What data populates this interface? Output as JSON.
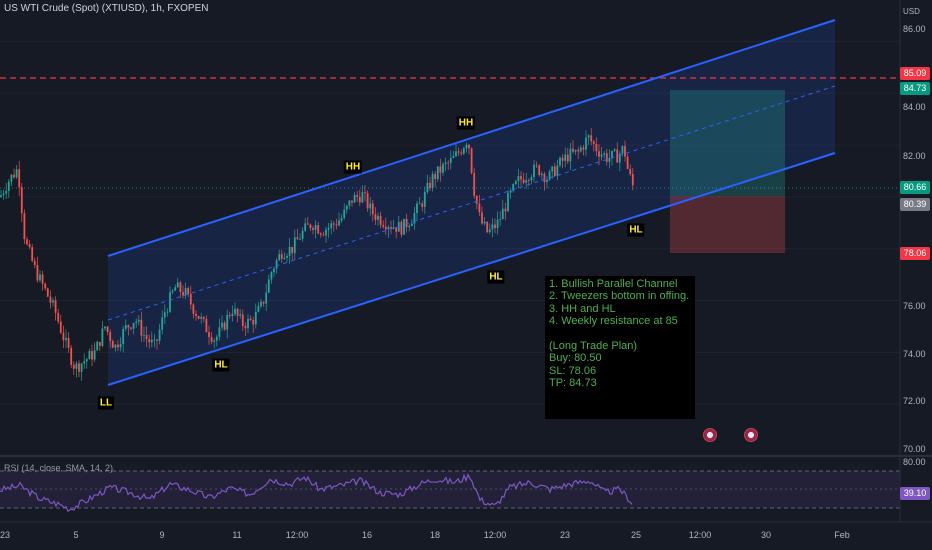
{
  "header": {
    "symbol_title": "US WTI Crude (Spot) (XTIUSD), 1h, FXOPEN",
    "currency": "USD"
  },
  "rsi_panel": {
    "title": "RSI (14, close, SMA, 14, 2)",
    "upper_label": "80.00",
    "value_label": "39.10"
  },
  "price_axis": {
    "ticks": [
      "86.00",
      "84.00",
      "82.00",
      "76.00",
      "74.00",
      "72.00",
      "70.00"
    ]
  },
  "price_tags": {
    "resistance": "85.09",
    "take_profit": "84.73",
    "current": "80.66",
    "entry": "80.39",
    "stop_loss": "78.06"
  },
  "date_axis": {
    "ticks": [
      "23",
      "5",
      "9",
      "11",
      "12:00",
      "16",
      "18",
      "12:00",
      "23",
      "25",
      "12:00",
      "30",
      "Feb"
    ]
  },
  "pattern_labels": {
    "ll": "LL",
    "hl_1": "HL",
    "hh_1": "HH",
    "hh_2": "HH",
    "hl_2": "HL",
    "hl_3": "HL"
  },
  "notes": {
    "lines": [
      "1. Bullish Parallel Channel",
      "2. Tweezers bottom in offing.",
      "3. HH and HL",
      "4. Weekly resistance at 85",
      "",
      "(Long Trade Plan)",
      "Buy: 80.50",
      "SL: 78.06",
      "TP: 84.73"
    ]
  },
  "colors": {
    "background": "#161a25",
    "bull_candle": "#26a69a",
    "bear_candle": "#ef5350",
    "channel_line": "#2962ff",
    "resistance_line": "#f23645",
    "rsi_line": "#7e57c2",
    "note_text": "#4caf50",
    "label_text": "#ffeb3b"
  },
  "chart_data": {
    "type": "candlestick",
    "y_range": [
      70,
      87.6
    ],
    "x_range_labels": [
      "23",
      "Feb"
    ],
    "resistance_level": 85.09,
    "trade": {
      "entry": 80.39,
      "stop_loss": 78.06,
      "take_profit": 84.73
    },
    "close_path": [
      {
        "x": 0,
        "y": 80.0
      },
      {
        "x": 8,
        "y": 80.6
      },
      {
        "x": 18,
        "y": 81.1
      },
      {
        "x": 25,
        "y": 78.3
      },
      {
        "x": 35,
        "y": 77.2
      },
      {
        "x": 45,
        "y": 76.4
      },
      {
        "x": 55,
        "y": 75.6
      },
      {
        "x": 65,
        "y": 74.4
      },
      {
        "x": 75,
        "y": 73.4
      },
      {
        "x": 85,
        "y": 73.7
      },
      {
        "x": 95,
        "y": 74.0
      },
      {
        "x": 105,
        "y": 75.0
      },
      {
        "x": 115,
        "y": 74.2
      },
      {
        "x": 125,
        "y": 74.9
      },
      {
        "x": 135,
        "y": 75.3
      },
      {
        "x": 145,
        "y": 74.6
      },
      {
        "x": 155,
        "y": 74.2
      },
      {
        "x": 165,
        "y": 75.6
      },
      {
        "x": 175,
        "y": 76.5
      },
      {
        "x": 185,
        "y": 76.3
      },
      {
        "x": 195,
        "y": 75.6
      },
      {
        "x": 205,
        "y": 75.0
      },
      {
        "x": 215,
        "y": 74.5
      },
      {
        "x": 222,
        "y": 74.9
      },
      {
        "x": 232,
        "y": 75.7
      },
      {
        "x": 242,
        "y": 75.1
      },
      {
        "x": 252,
        "y": 75.2
      },
      {
        "x": 262,
        "y": 75.8
      },
      {
        "x": 272,
        "y": 77.2
      },
      {
        "x": 282,
        "y": 77.9
      },
      {
        "x": 292,
        "y": 78.0
      },
      {
        "x": 302,
        "y": 78.6
      },
      {
        "x": 312,
        "y": 79.0
      },
      {
        "x": 322,
        "y": 78.7
      },
      {
        "x": 332,
        "y": 78.9
      },
      {
        "x": 342,
        "y": 79.2
      },
      {
        "x": 352,
        "y": 79.9
      },
      {
        "x": 362,
        "y": 80.1
      },
      {
        "x": 372,
        "y": 79.4
      },
      {
        "x": 382,
        "y": 79.1
      },
      {
        "x": 392,
        "y": 78.9
      },
      {
        "x": 402,
        "y": 78.8
      },
      {
        "x": 412,
        "y": 79.2
      },
      {
        "x": 422,
        "y": 79.8
      },
      {
        "x": 432,
        "y": 80.7
      },
      {
        "x": 442,
        "y": 81.1
      },
      {
        "x": 452,
        "y": 81.4
      },
      {
        "x": 462,
        "y": 81.9
      },
      {
        "x": 468,
        "y": 82.3
      },
      {
        "x": 474,
        "y": 80.3
      },
      {
        "x": 480,
        "y": 79.1
      },
      {
        "x": 488,
        "y": 78.6
      },
      {
        "x": 498,
        "y": 79.0
      },
      {
        "x": 508,
        "y": 79.9
      },
      {
        "x": 518,
        "y": 80.6
      },
      {
        "x": 528,
        "y": 80.9
      },
      {
        "x": 538,
        "y": 81.1
      },
      {
        "x": 548,
        "y": 80.7
      },
      {
        "x": 558,
        "y": 81.2
      },
      {
        "x": 568,
        "y": 81.6
      },
      {
        "x": 578,
        "y": 81.7
      },
      {
        "x": 588,
        "y": 82.3
      },
      {
        "x": 598,
        "y": 81.8
      },
      {
        "x": 608,
        "y": 81.5
      },
      {
        "x": 618,
        "y": 81.6
      },
      {
        "x": 624,
        "y": 81.9
      },
      {
        "x": 628,
        "y": 81.0
      },
      {
        "x": 633,
        "y": 80.4
      }
    ],
    "rsi_path": [
      {
        "x": 0,
        "y": 55
      },
      {
        "x": 20,
        "y": 60
      },
      {
        "x": 40,
        "y": 45
      },
      {
        "x": 60,
        "y": 38
      },
      {
        "x": 70,
        "y": 33
      },
      {
        "x": 90,
        "y": 45
      },
      {
        "x": 110,
        "y": 58
      },
      {
        "x": 130,
        "y": 52
      },
      {
        "x": 150,
        "y": 44
      },
      {
        "x": 170,
        "y": 62
      },
      {
        "x": 190,
        "y": 55
      },
      {
        "x": 210,
        "y": 46
      },
      {
        "x": 230,
        "y": 57
      },
      {
        "x": 250,
        "y": 50
      },
      {
        "x": 270,
        "y": 68
      },
      {
        "x": 290,
        "y": 62
      },
      {
        "x": 305,
        "y": 70
      },
      {
        "x": 320,
        "y": 56
      },
      {
        "x": 340,
        "y": 60
      },
      {
        "x": 360,
        "y": 66
      },
      {
        "x": 380,
        "y": 52
      },
      {
        "x": 400,
        "y": 50
      },
      {
        "x": 420,
        "y": 62
      },
      {
        "x": 435,
        "y": 68
      },
      {
        "x": 455,
        "y": 64
      },
      {
        "x": 470,
        "y": 72
      },
      {
        "x": 480,
        "y": 44
      },
      {
        "x": 495,
        "y": 36
      },
      {
        "x": 510,
        "y": 58
      },
      {
        "x": 530,
        "y": 64
      },
      {
        "x": 550,
        "y": 56
      },
      {
        "x": 570,
        "y": 62
      },
      {
        "x": 590,
        "y": 66
      },
      {
        "x": 605,
        "y": 52
      },
      {
        "x": 620,
        "y": 56
      },
      {
        "x": 633,
        "y": 39.1
      }
    ]
  }
}
